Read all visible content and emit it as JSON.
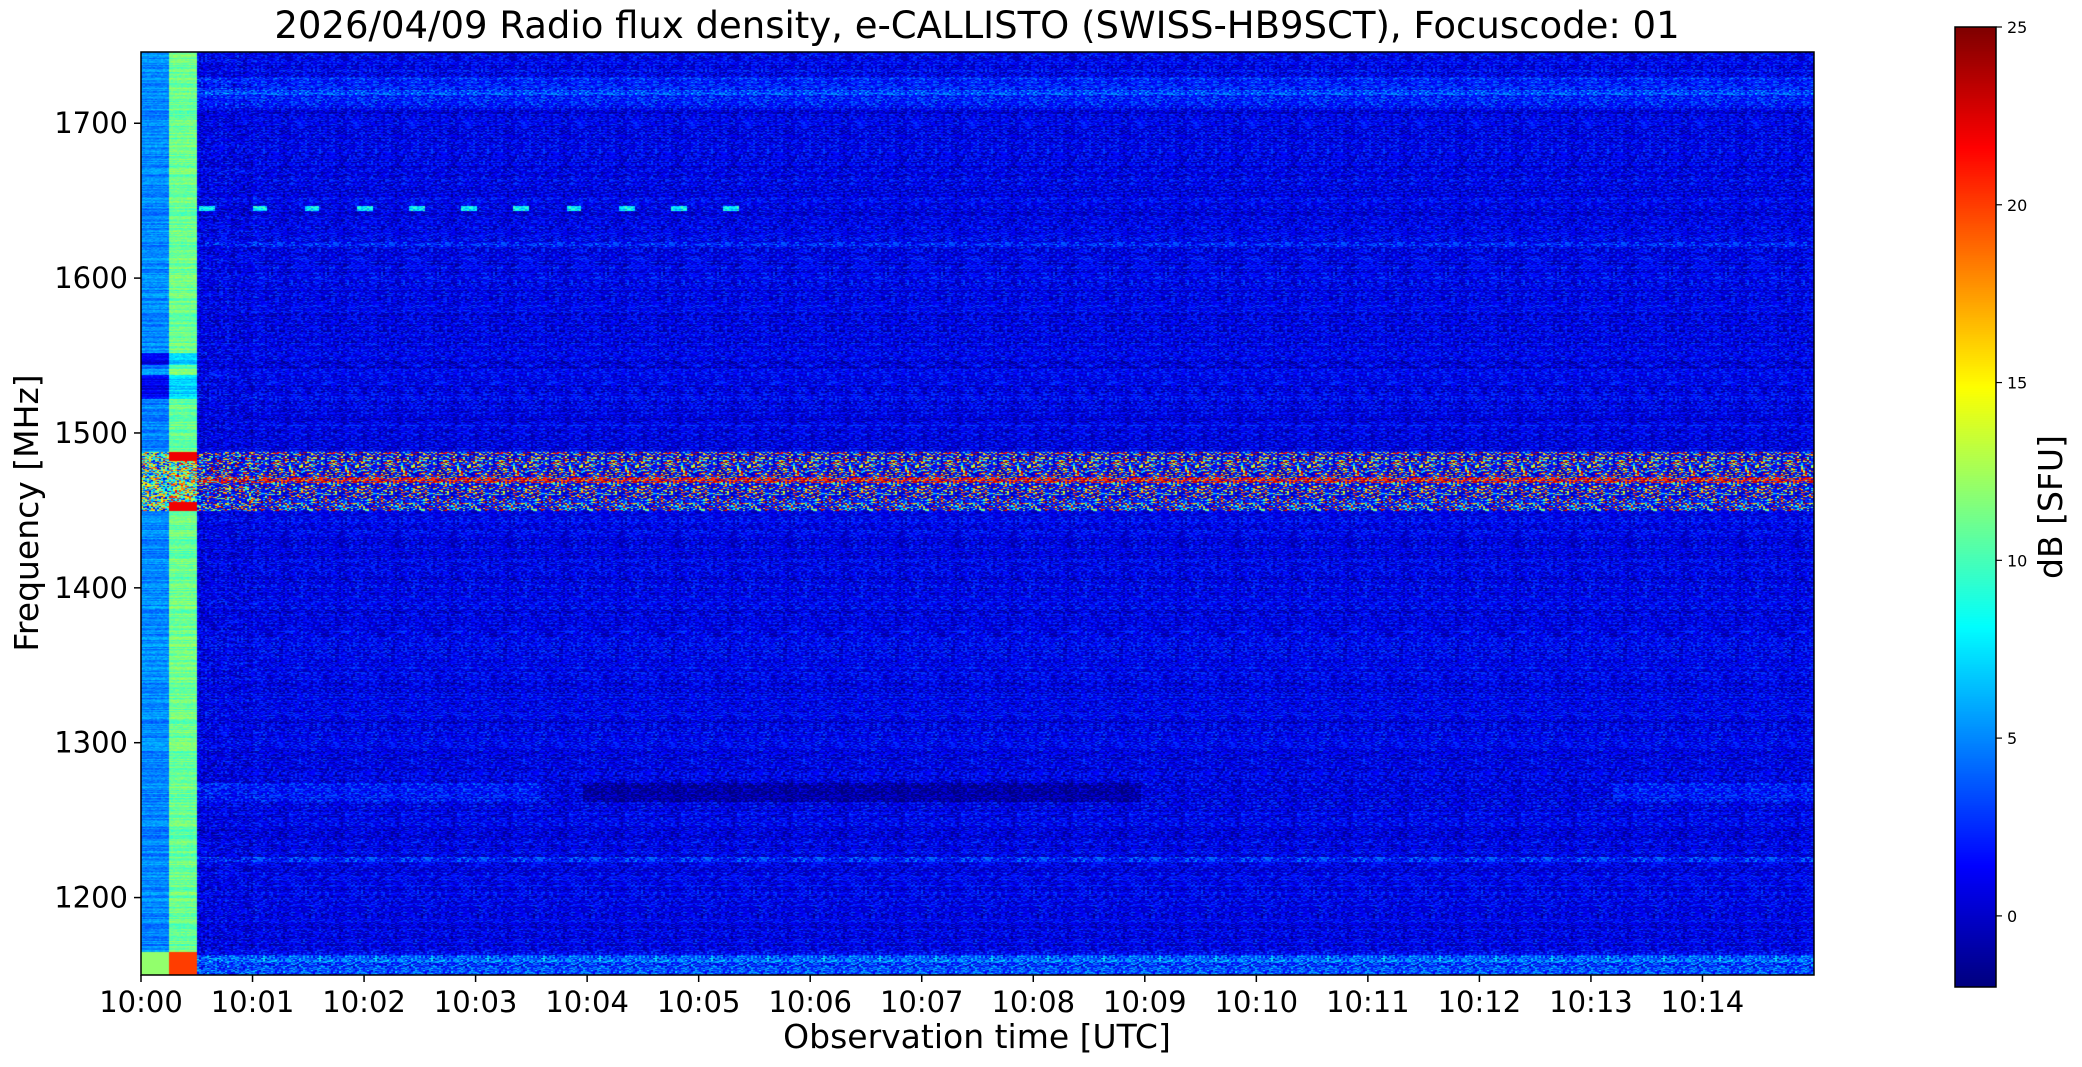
{
  "chart_data": {
    "type": "heatmap",
    "title": "2026/04/09  Radio flux density, e-CALLISTO (SWISS-HB9SCT), Focuscode: 01",
    "xlabel": "Observation time [UTC]",
    "ylabel": "Frequency [MHz]",
    "colorbar_label": "dB [SFU]",
    "colormap": "jet",
    "x_range": [
      "10:00",
      "10:15"
    ],
    "x_ticks": [
      "10:00",
      "10:01",
      "10:02",
      "10:03",
      "10:04",
      "10:05",
      "10:06",
      "10:07",
      "10:08",
      "10:09",
      "10:10",
      "10:11",
      "10:12",
      "10:13",
      "10:14"
    ],
    "y_range": [
      1150,
      1746
    ],
    "y_ticks": [
      1200,
      1300,
      1400,
      1500,
      1600,
      1700
    ],
    "color_range": [
      -2,
      25
    ],
    "color_ticks": [
      0,
      5,
      10,
      15,
      20,
      25
    ],
    "features": {
      "background_level_db": 1,
      "interference_band_mhz": [
        1450,
        1488
      ],
      "interference_band_level_db": [
        0,
        25
      ],
      "calibration_columns": [
        {
          "time": [
            "10:00:00",
            "10:00:15"
          ],
          "level_db": 5
        },
        {
          "time": [
            "10:00:15",
            "10:00:30"
          ],
          "level_db": 11
        }
      ],
      "narrow_lines_mhz": [
        1160,
        1225,
        1622,
        1645,
        1720
      ],
      "faint_dip_mhz": 1268
    }
  }
}
